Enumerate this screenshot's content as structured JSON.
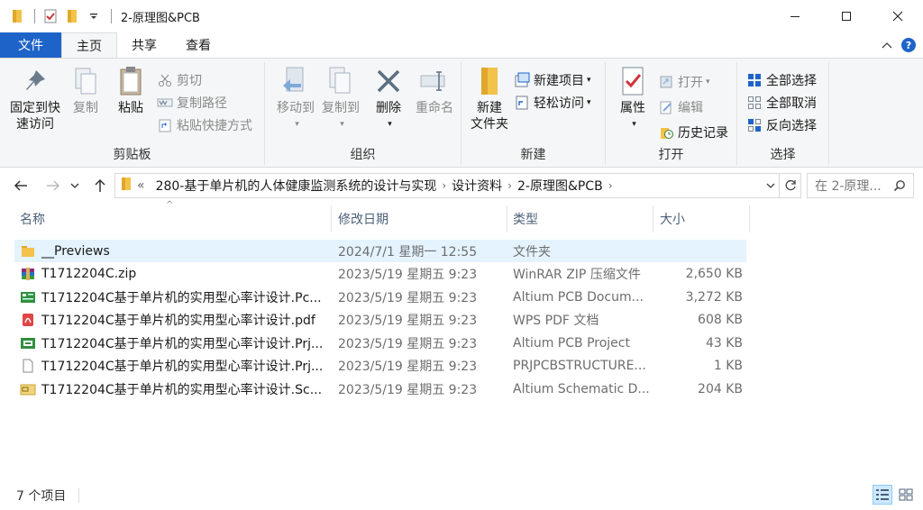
{
  "window": {
    "title": "2-原理图&PCB"
  },
  "ribbon_tabs": {
    "file": "文件",
    "home": "主页",
    "share": "共享",
    "view": "查看"
  },
  "clipboard": {
    "pin_line1": "固定到快",
    "pin_line2": "速访问",
    "copy": "复制",
    "paste": "粘贴",
    "cut": "剪切",
    "copy_path": "复制路径",
    "paste_shortcut": "粘贴快捷方式",
    "label": "剪贴板"
  },
  "organize": {
    "move_to": "移动到",
    "copy_to": "复制到",
    "delete": "删除",
    "rename": "重命名",
    "label": "组织"
  },
  "new_group": {
    "new_folder_line1": "新建",
    "new_folder_line2": "文件夹",
    "new_item": "新建项目",
    "easy_access": "轻松访问",
    "label": "新建"
  },
  "open_group": {
    "properties": "属性",
    "open": "打开",
    "edit": "编辑",
    "history": "历史记录",
    "label": "打开"
  },
  "select_group": {
    "select_all": "全部选择",
    "select_none": "全部取消",
    "invert": "反向选择",
    "label": "选择"
  },
  "address": {
    "overflow": "«",
    "crumbs": [
      "280-基于单片机的人体健康监测系统的设计与实现",
      "设计资料",
      "2-原理图&PCB"
    ]
  },
  "search": {
    "placeholder": "在 2-原理..."
  },
  "columns": {
    "name": "名称",
    "date": "修改日期",
    "type": "类型",
    "size": "大小"
  },
  "files": [
    {
      "name": "__Previews",
      "date": "2024/7/1 星期一 12:55",
      "type": "文件夹",
      "size": "",
      "icon": "folder-icon"
    },
    {
      "name": "T1712204C.zip",
      "date": "2023/5/19 星期五 9:23",
      "type": "WinRAR ZIP 压缩文件",
      "size": "2,650 KB",
      "icon": "winrar-icon"
    },
    {
      "name": "T1712204C基于单片机的实用型心率计设计.Pc...",
      "date": "2023/5/19 星期五 9:23",
      "type": "Altium PCB Docum...",
      "size": "3,272 KB",
      "icon": "pcb-doc-icon"
    },
    {
      "name": "T1712204C基于单片机的实用型心率计设计.pdf",
      "date": "2023/5/19 星期五 9:23",
      "type": "WPS PDF 文档",
      "size": "608 KB",
      "icon": "pdf-icon"
    },
    {
      "name": "T1712204C基于单片机的实用型心率计设计.Prj...",
      "date": "2023/5/19 星期五 9:23",
      "type": "Altium PCB Project",
      "size": "43 KB",
      "icon": "pcb-project-icon"
    },
    {
      "name": "T1712204C基于单片机的实用型心率计设计.Prj...",
      "date": "2023/5/19 星期五 9:23",
      "type": "PRJPCBSTRUCTURE...",
      "size": "1 KB",
      "icon": "blank-file-icon"
    },
    {
      "name": "T1712204C基于单片机的实用型心率计设计.Sc...",
      "date": "2023/5/19 星期五 9:23",
      "type": "Altium Schematic D...",
      "size": "204 KB",
      "icon": "schematic-icon"
    }
  ],
  "status": {
    "count": "7 个项目"
  }
}
